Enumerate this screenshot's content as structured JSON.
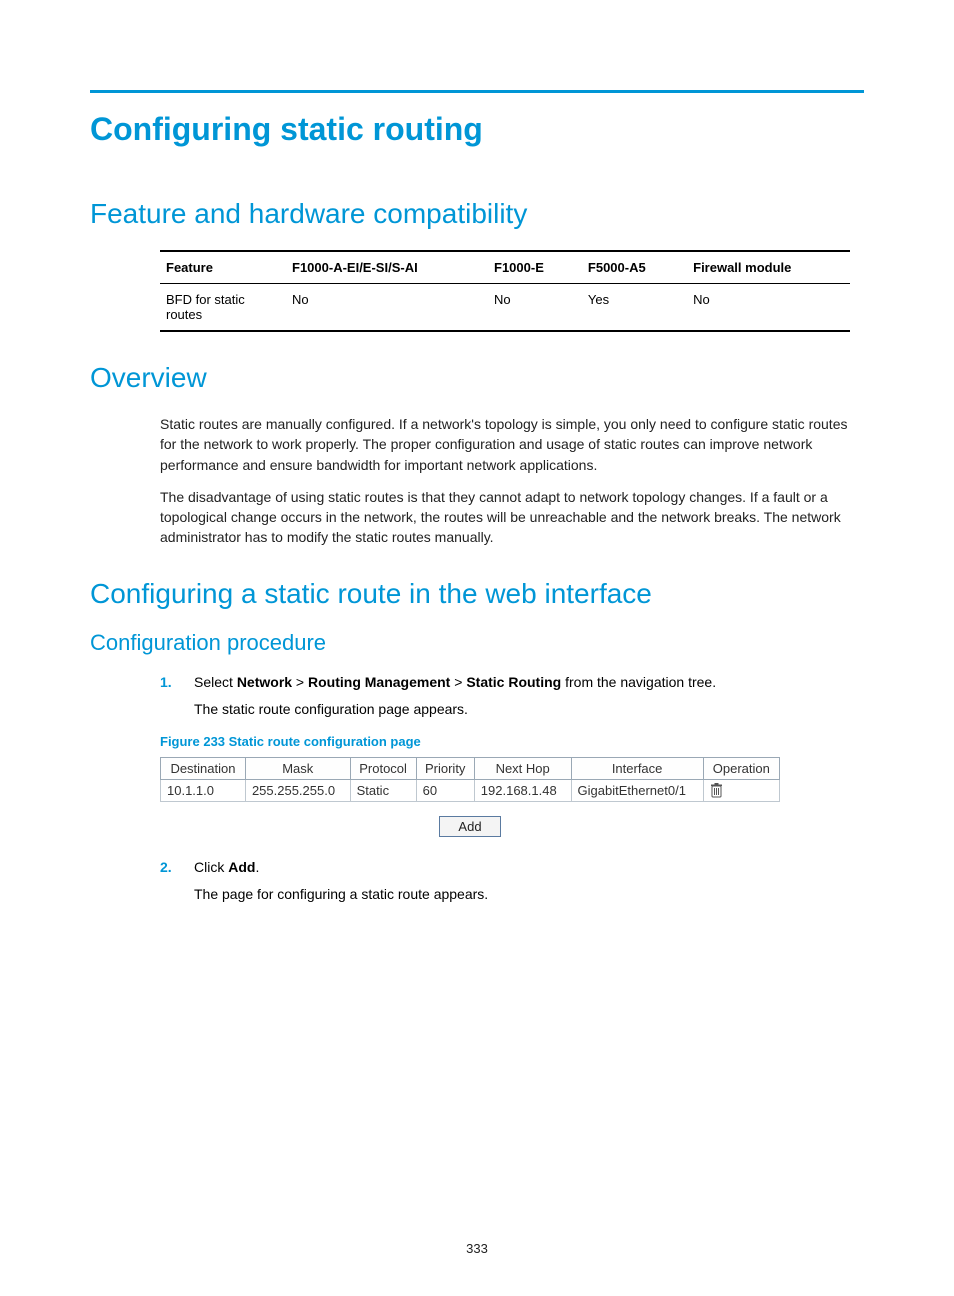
{
  "title": "Configuring static routing",
  "sections": {
    "compat": {
      "heading": "Feature and hardware compatibility",
      "table": {
        "headers": [
          "Feature",
          "F1000-A-EI/E-SI/S-AI",
          "F1000-E",
          "F5000-A5",
          "Firewall module"
        ],
        "rows": [
          [
            "BFD for static routes",
            "No",
            "No",
            "Yes",
            "No"
          ]
        ]
      }
    },
    "overview": {
      "heading": "Overview",
      "paragraphs": [
        "Static routes are manually configured. If a network's topology is simple, you only need to configure static routes for the network to work properly. The proper configuration and usage of static routes can improve network performance and ensure bandwidth for important network applications.",
        "The disadvantage of using static routes is that they cannot adapt to network topology changes. If a fault or a topological change occurs in the network, the routes will be unreachable and the network breaks. The network administrator has to modify the static routes manually."
      ]
    },
    "config": {
      "heading": "Configuring a static route in the web interface",
      "sub_heading": "Configuration procedure",
      "steps": {
        "step1": {
          "num": "1.",
          "prefix": "Select ",
          "nav1": "Network",
          "sep": " > ",
          "nav2": "Routing Management",
          "nav3": "Static Routing",
          "suffix": " from the navigation tree.",
          "sub": "The static route configuration page appears."
        },
        "figure_caption": "Figure 233 Static route configuration page",
        "ui_table": {
          "headers": [
            "Destination",
            "Mask",
            "Protocol",
            "Priority",
            "Next Hop",
            "Interface",
            "Operation"
          ],
          "row": {
            "destination": "10.1.1.0",
            "mask": "255.255.255.0",
            "protocol": "Static",
            "priority": "60",
            "nexthop": "192.168.1.48",
            "interface": "GigabitEthernet0/1"
          }
        },
        "add_label": "Add",
        "step2": {
          "num": "2.",
          "prefix": "Click ",
          "bold": "Add",
          "suffix": ".",
          "sub": "The page for configuring a static route appears."
        }
      }
    }
  },
  "page_number": "333"
}
